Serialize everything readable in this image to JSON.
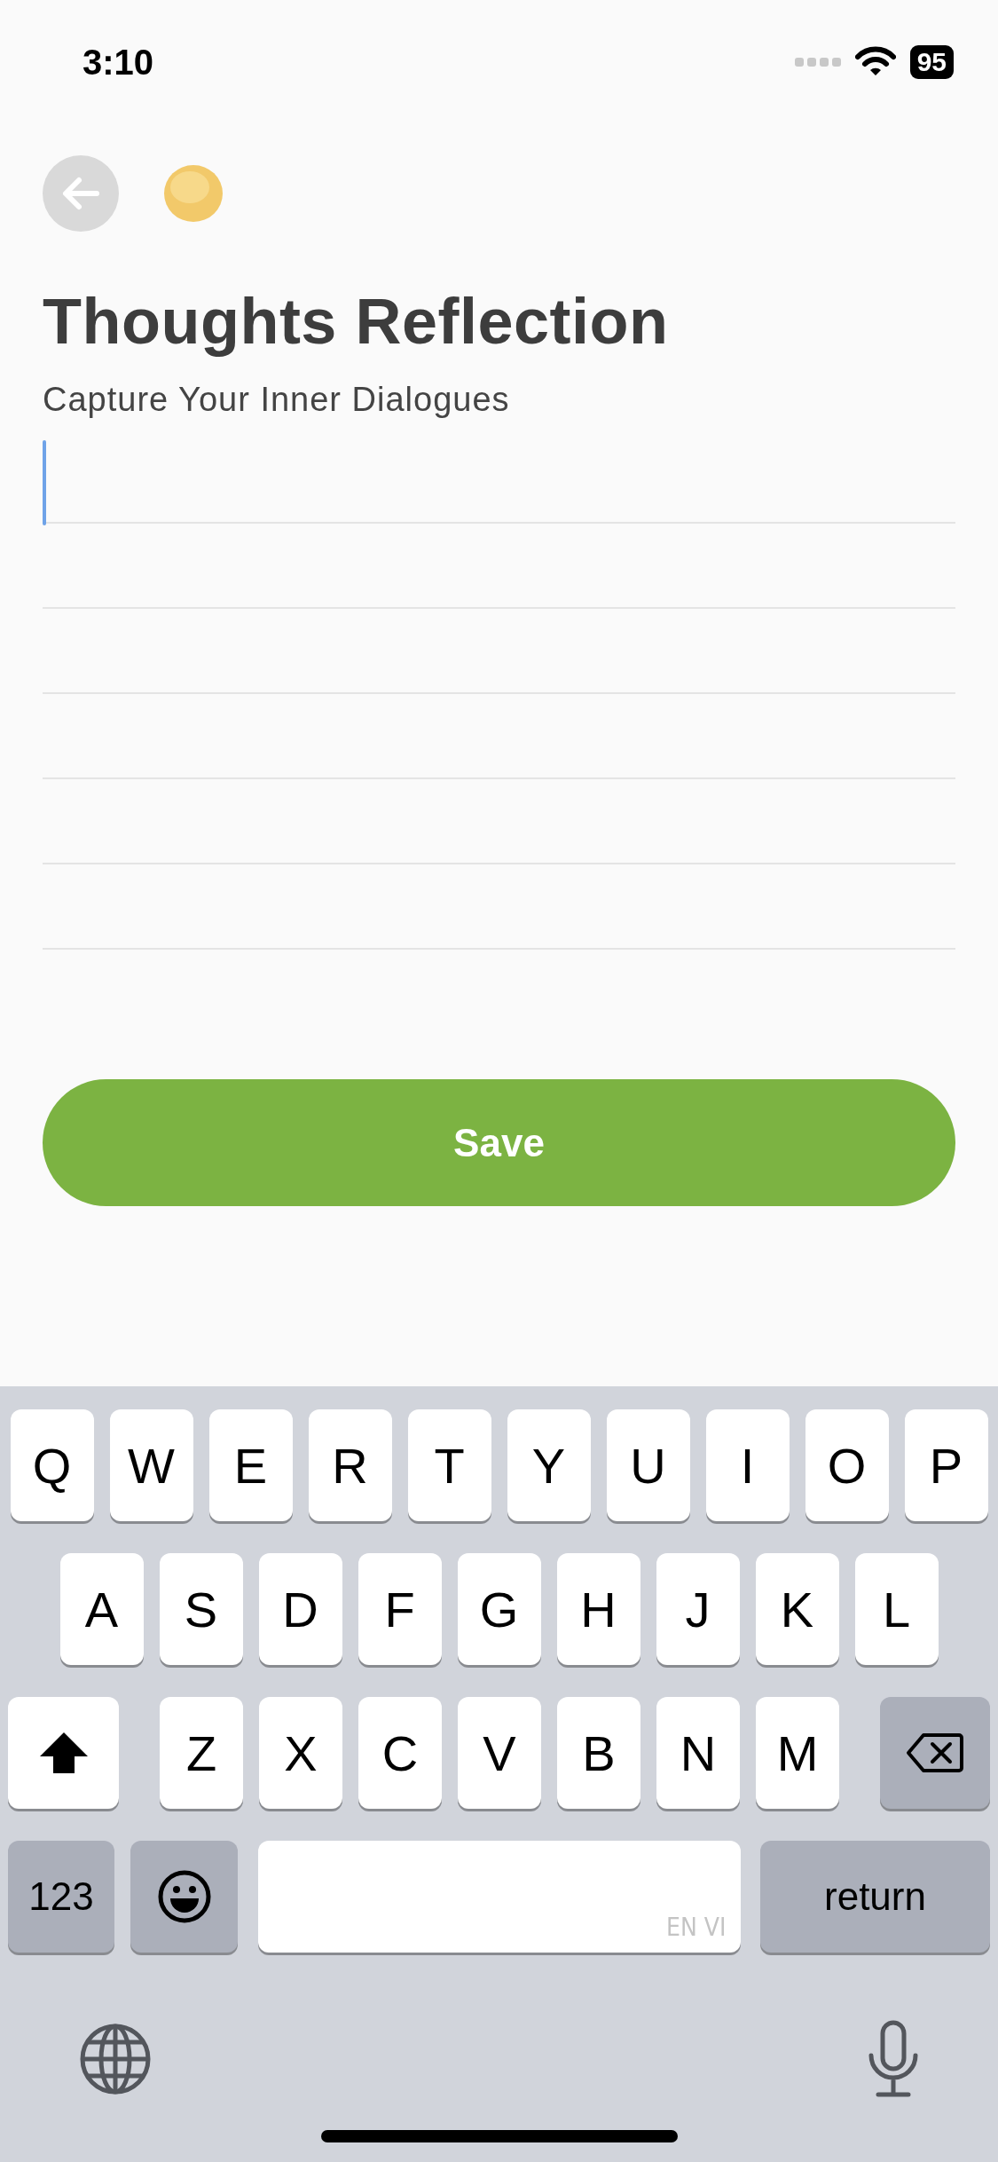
{
  "status_bar": {
    "time": "3:10",
    "battery": "95"
  },
  "header": {
    "title": "Thoughts Reflection",
    "subtitle": "Capture Your Inner Dialogues"
  },
  "entry": {
    "focused": true
  },
  "save_button": {
    "label": "Save"
  },
  "keyboard": {
    "rows": [
      [
        "Q",
        "W",
        "E",
        "R",
        "T",
        "Y",
        "U",
        "I",
        "O",
        "P"
      ],
      [
        "A",
        "S",
        "D",
        "F",
        "G",
        "H",
        "J",
        "K",
        "L"
      ],
      [
        "Z",
        "X",
        "C",
        "V",
        "B",
        "N",
        "M"
      ]
    ],
    "numbers_key": "123",
    "space_hint": "EN VI",
    "return_key": "return"
  }
}
